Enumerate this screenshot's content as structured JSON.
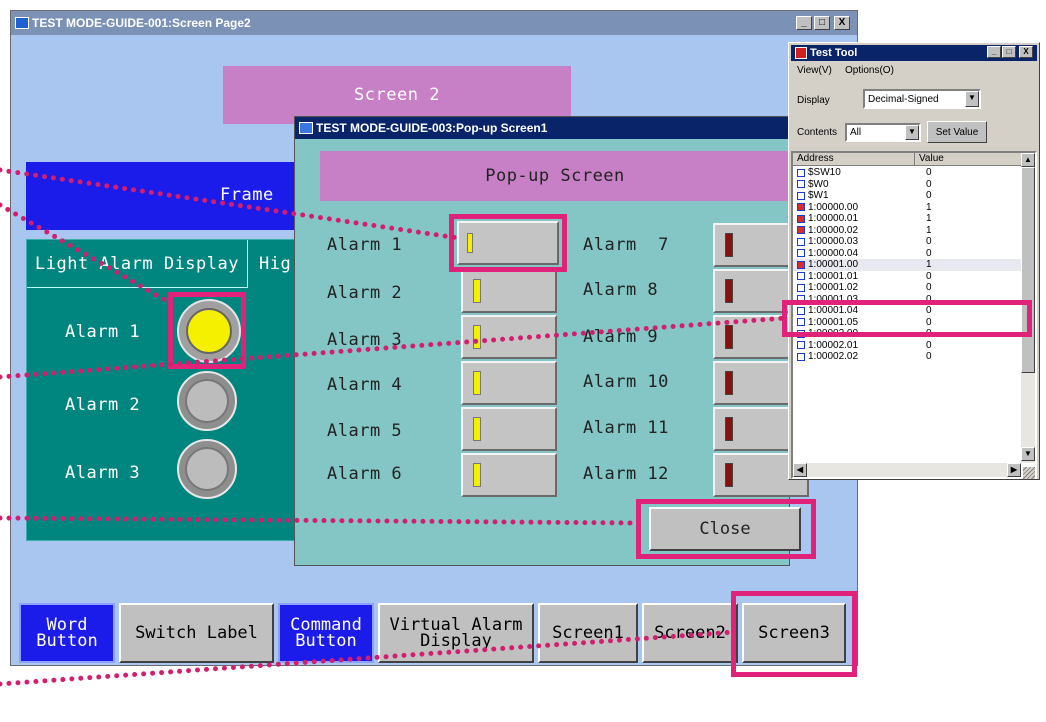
{
  "main_window": {
    "title": "TEST MODE-GUIDE-001:Screen Page2",
    "caption_buttons": [
      "_",
      "□",
      "X"
    ],
    "screen_label": "Screen 2",
    "frame_label": "Frame",
    "tabs": [
      "Light Alarm Display",
      "Hig"
    ],
    "alarms": [
      "Alarm 1",
      "Alarm 2",
      "Alarm 3"
    ],
    "bottom_buttons": [
      "Word\nButton",
      "Switch Label",
      "Command\nButton",
      "Virtual Alarm\nDisplay",
      "Screen1",
      "Screen2",
      "Screen3"
    ]
  },
  "popup": {
    "title": "TEST MODE-GUIDE-003:Pop-up Screen1",
    "header": "Pop-up Screen",
    "alarms_left": [
      "Alarm 1",
      "Alarm 2",
      "Alarm 3",
      "Alarm 4",
      "Alarm 5",
      "Alarm 6"
    ],
    "alarms_right": [
      "Alarm  7",
      "Alarm 8",
      "Alarm 9",
      "Alarm 10",
      "Alarm 11",
      "Alarm 12"
    ],
    "close_label": "Close"
  },
  "test_tool": {
    "title": "Test Tool",
    "menu": [
      "View(V)",
      "Options(O)"
    ],
    "display_label": "Display",
    "display_value": "Decimal-Signed",
    "contents_label": "Contents",
    "contents_value": "All",
    "set_value_label": "Set Value",
    "columns": [
      "Address",
      "Value"
    ],
    "rows": [
      {
        "addr": "$SW10",
        "val": "0",
        "checked": false
      },
      {
        "addr": "$W0",
        "val": "0",
        "checked": false
      },
      {
        "addr": "$W1",
        "val": "0",
        "checked": false
      },
      {
        "addr": "1:00000.00",
        "val": "1",
        "checked": true
      },
      {
        "addr": "1:00000.01",
        "val": "1",
        "checked": true
      },
      {
        "addr": "1:00000.02",
        "val": "1",
        "checked": true
      },
      {
        "addr": "1:00000.03",
        "val": "0",
        "checked": false
      },
      {
        "addr": "1:00000.04",
        "val": "0",
        "checked": false
      },
      {
        "addr": "1:00001.00",
        "val": "1",
        "checked": true
      },
      {
        "addr": "1:00001.01",
        "val": "0",
        "checked": false
      },
      {
        "addr": "1:00001.02",
        "val": "0",
        "checked": false
      },
      {
        "addr": "1:00001.03",
        "val": "0",
        "checked": false
      },
      {
        "addr": "1:00001.04",
        "val": "0",
        "checked": false
      },
      {
        "addr": "1:00001.05",
        "val": "0",
        "checked": false
      },
      {
        "addr": "1:00002.00",
        "val": "0",
        "checked": false
      },
      {
        "addr": "1:00002.01",
        "val": "0",
        "checked": false
      },
      {
        "addr": "1:00002.02",
        "val": "0",
        "checked": false
      }
    ]
  },
  "colors": {
    "title_bar_inactive": "#7b92b6",
    "title_bar_active": "#0a246a",
    "screen_bg": "#a8c6f0",
    "purple": "#c77fc6",
    "teal": "#00857f",
    "popup_bg": "#84c5c6",
    "highlight": "#e0227a",
    "dotted": "#d31e6f"
  }
}
